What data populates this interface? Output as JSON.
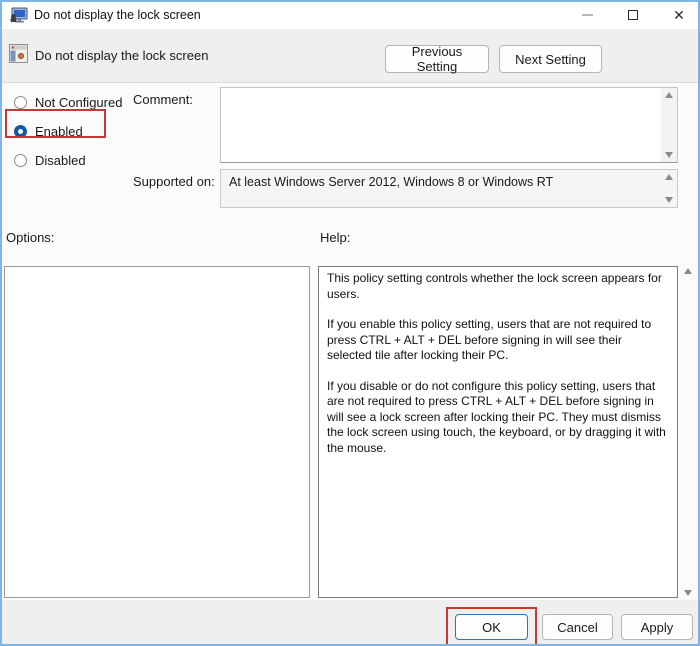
{
  "window": {
    "title": "Do not display the lock screen"
  },
  "header": {
    "policy_name": "Do not display the lock screen",
    "previous_label": "Previous Setting",
    "next_label": "Next Setting"
  },
  "settings": {
    "radios": [
      {
        "label": "Not Configured",
        "selected": false,
        "highlighted": false
      },
      {
        "label": "Enabled",
        "selected": true,
        "highlighted": true
      },
      {
        "label": "Disabled",
        "selected": false,
        "highlighted": false
      }
    ],
    "comment": {
      "label": "Comment:",
      "value": ""
    },
    "supported": {
      "label": "Supported on:",
      "value": "At least Windows Server 2012, Windows 8 or Windows RT"
    }
  },
  "panels": {
    "options_label": "Options:",
    "help_label": "Help:",
    "help_paragraphs": [
      "This policy setting controls whether the lock screen appears for users.",
      "If you enable this policy setting, users that are not required to press CTRL + ALT + DEL before signing in will see their selected tile after locking their PC.",
      "If you disable or do not configure this policy setting, users that are not required to press CTRL + ALT + DEL before signing in will see a lock screen after locking their PC. They must dismiss the lock screen using touch, the keyboard, or by dragging it with the mouse."
    ]
  },
  "footer": {
    "ok_label": "OK",
    "cancel_label": "Cancel",
    "apply_label": "Apply"
  },
  "icons": {
    "close_glyph": "✕"
  },
  "colors": {
    "highlight_red": "#c23b31",
    "radio_accent": "#0e5aa7",
    "outer_border_blue": "#7fb5e5"
  }
}
